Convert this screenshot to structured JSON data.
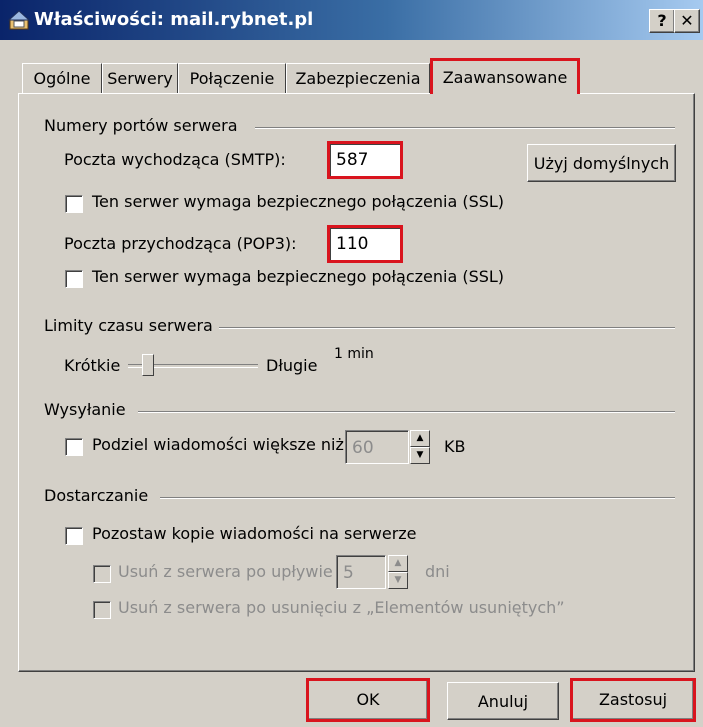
{
  "window": {
    "title": "Właściwości: mail.rybnet.pl",
    "help_label": "?",
    "close_label": "✕"
  },
  "tabs": [
    {
      "label": "Ogólne"
    },
    {
      "label": "Serwery"
    },
    {
      "label": "Połączenie"
    },
    {
      "label": "Zabezpieczenia"
    },
    {
      "label": "Zaawansowane",
      "active": true
    }
  ],
  "ports": {
    "group_title": "Numery portów serwera",
    "smtp_label": "Poczta wychodząca (SMTP):",
    "smtp_value": "587",
    "defaults_button": "Użyj domyślnych",
    "smtp_ssl_label": "Ten serwer wymaga bezpiecznego połączenia (SSL)",
    "pop3_label": "Poczta przychodząca (POP3):",
    "pop3_value": "110",
    "pop3_ssl_label": "Ten serwer wymaga bezpiecznego połączenia (SSL)"
  },
  "timeouts": {
    "group_title": "Limity czasu serwera",
    "short_label": "Krótkie",
    "long_label": "Długie",
    "value_label": "1 min",
    "slider_level": 0.12
  },
  "sending": {
    "group_title": "Wysyłanie",
    "split_label": "Podziel wiadomości większe niż",
    "split_value": "60",
    "unit": "KB"
  },
  "delivery": {
    "group_title": "Dostarczanie",
    "keep_copy_label": "Pozostaw kopie wiadomości na serwerze",
    "remove_after_label": "Usuń z serwera po upływie",
    "remove_after_value": "5",
    "days_unit": "dni",
    "remove_deleted_label": "Usuń z serwera po usunięciu z „Elementów usuniętych”"
  },
  "buttons": {
    "ok": "OK",
    "cancel": "Anuluj",
    "apply": "Zastosuj"
  },
  "colors": {
    "highlight": "#d9141e",
    "titlebar": "#0a246a",
    "face": "#d4d0c8"
  }
}
